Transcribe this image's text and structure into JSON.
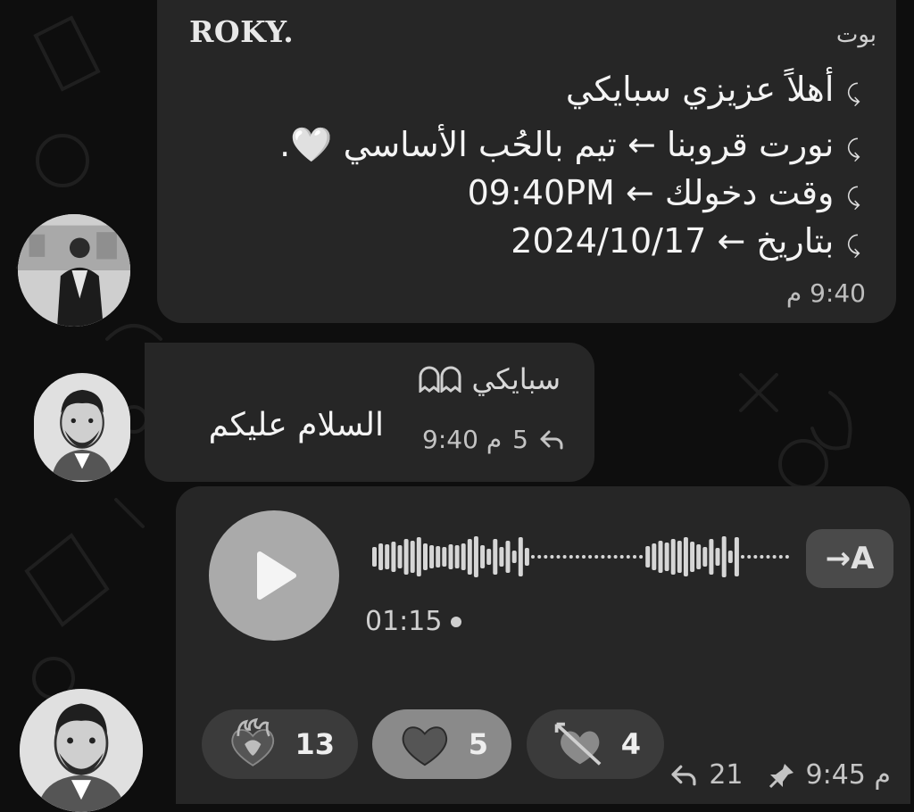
{
  "bot_message": {
    "logo": "ROKY.",
    "sender_label": "بوت",
    "marker": "⤹",
    "lines": [
      "أهلاً عزيزي سبايكي",
      "نورت قروبنا ← تيم بالحُب الأساسي 🤍.",
      "وقت دخولك ← 09:40PM",
      "بتاريخ ← 2024/10/17"
    ],
    "time": "9:40 م"
  },
  "text_message": {
    "sender_name": "سبايكي",
    "text": "السلام عليكم",
    "time": "9:40 م",
    "replies": "5"
  },
  "voice_message": {
    "duration": "01:15",
    "transcribe_label": "→A",
    "reactions": [
      {
        "emoji": "heart-on-fire",
        "count": "13"
      },
      {
        "emoji": "heart",
        "count": "5"
      },
      {
        "emoji": "heart-with-arrow",
        "count": "4"
      }
    ],
    "replies": "21",
    "time": "9:45 م"
  }
}
